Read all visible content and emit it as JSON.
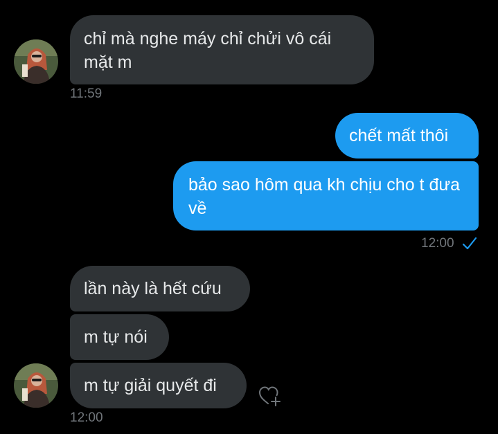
{
  "conversation": {
    "group1": {
      "messages": [
        "chỉ mà nghe máy chỉ chửi vô cái mặt m"
      ],
      "time": "11:59"
    },
    "group2": {
      "messages": [
        "chết mất thôi",
        "bảo sao hôm qua kh chịu cho t đưa về"
      ],
      "time": "12:00",
      "status_icon": "check-icon"
    },
    "group3": {
      "messages": [
        "lần này là hết cứu",
        "m tự nói",
        "m tự giải quyết đi"
      ],
      "time": "12:00",
      "reaction_icon": "heart-add-icon"
    }
  },
  "colors": {
    "background": "#000000",
    "received_bubble": "#2f3336",
    "sent_bubble": "#1d9bf0",
    "timestamp": "#71767b",
    "check": "#1d9bf0"
  }
}
